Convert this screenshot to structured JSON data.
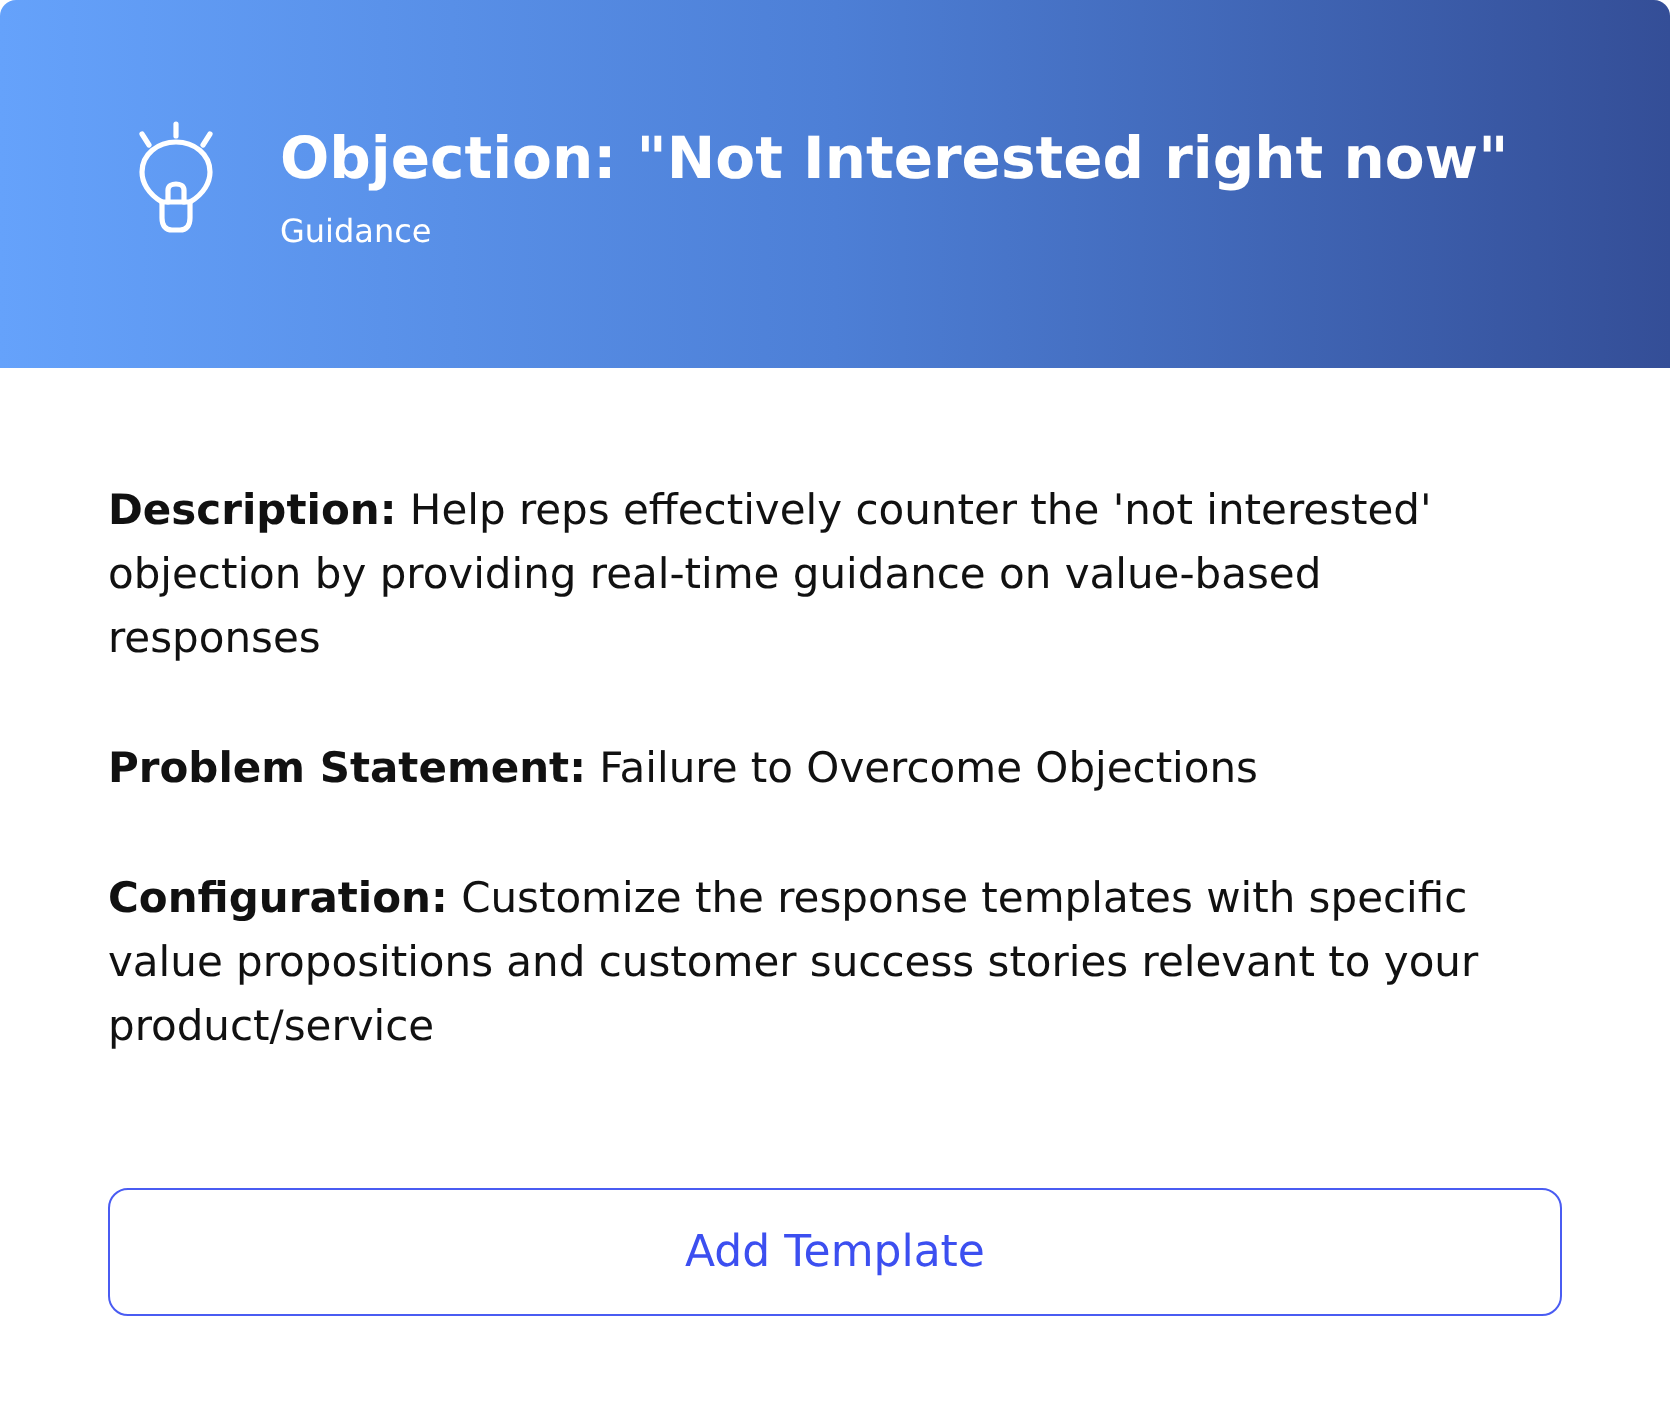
{
  "header": {
    "title": "Objection: \"Not Interested right now\"",
    "subtitle": "Guidance"
  },
  "sections": [
    {
      "text": "**Description:** Help reps effectively counter the 'not interested' objection by providing real-time guidance on value-based responses"
    },
    {
      "text": "**Problem Statement:** Failure to Overcome Objections"
    },
    {
      "text": "**Configuration:** Customize the response templates with specific value propositions and customer success stories relevant to your product/service"
    }
  ],
  "button": {
    "label": "Add Template"
  }
}
